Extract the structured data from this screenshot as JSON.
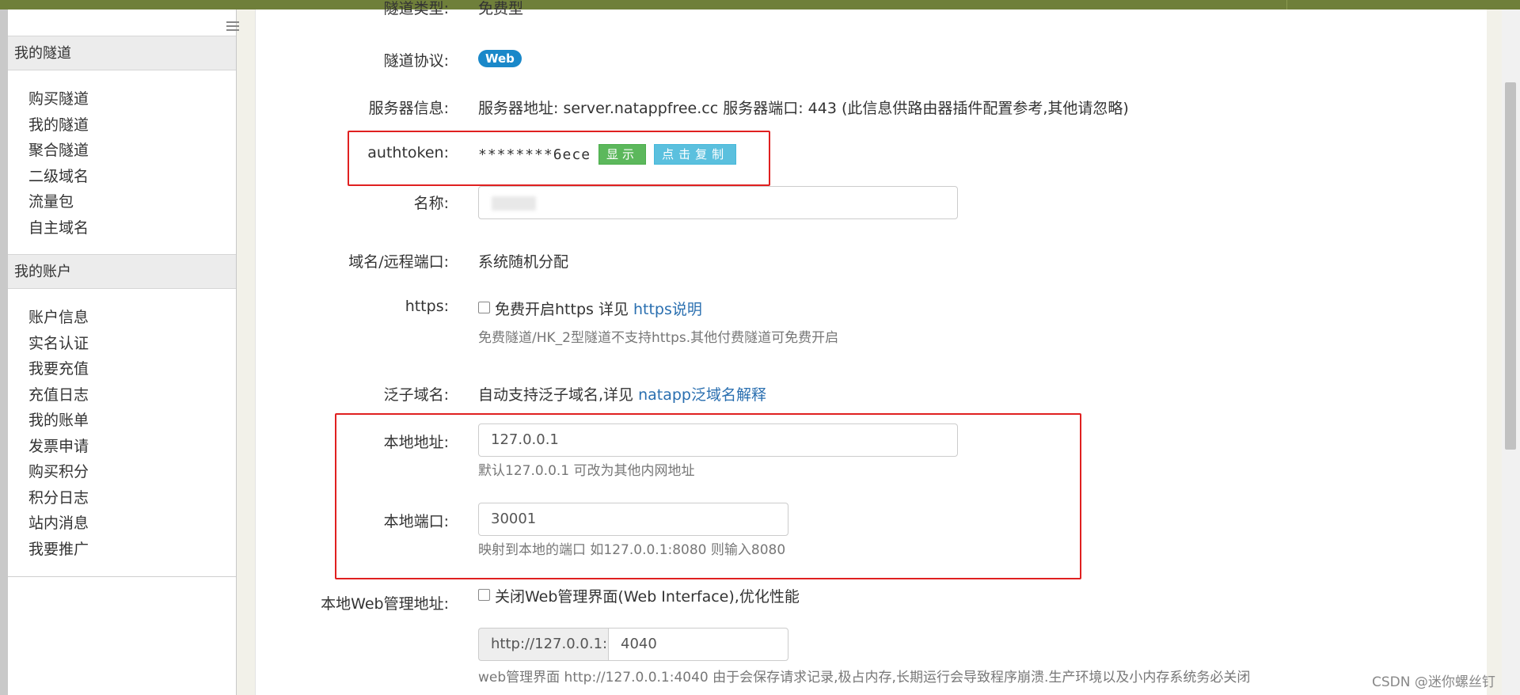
{
  "sidebar": {
    "sections": [
      {
        "title": "我的隧道",
        "items": [
          "购买隧道",
          "我的隧道",
          "聚合隧道",
          "二级域名",
          "流量包",
          "自主域名"
        ]
      },
      {
        "title": "我的账户",
        "items": [
          "账户信息",
          "实名认证",
          "我要充值",
          "充值日志",
          "我的账单",
          "发票申请",
          "购买积分",
          "积分日志",
          "站内消息",
          "我要推广"
        ]
      }
    ]
  },
  "form": {
    "tunnel_type": {
      "label": "隧道类型:",
      "value": "免费型"
    },
    "protocol": {
      "label": "隧道协议:",
      "badge": "Web"
    },
    "server": {
      "label": "服务器信息:",
      "value": "服务器地址: server.natappfree.cc 服务器端口: 443 (此信息供路由器插件配置参考,其他请忽略)"
    },
    "authtoken": {
      "label": "authtoken:",
      "value": "********6ece",
      "show_btn": "显示",
      "copy_btn": "点击复制"
    },
    "name": {
      "label": "名称:"
    },
    "domain_port": {
      "label": "域名/远程端口:",
      "value": "系统随机分配"
    },
    "https": {
      "label": "https:",
      "checkbox_text": "免费开启https 详见 ",
      "link": "https说明",
      "help": "免费隧道/HK_2型隧道不支持https.其他付费隧道可免费开启"
    },
    "wildcard": {
      "label": "泛子域名:",
      "text": "自动支持泛子域名,详见 ",
      "link": "natapp泛域名解释"
    },
    "local_addr": {
      "label": "本地地址:",
      "value": "127.0.0.1",
      "help": "默认127.0.0.1 可改为其他内网地址"
    },
    "local_port": {
      "label": "本地端口:",
      "value": "30001",
      "help": "映射到本地的端口 如127.0.0.1:8080 则输入8080"
    },
    "web_admin": {
      "label": "本地Web管理地址:",
      "checkbox_text": "关闭Web管理界面(Web Interface),优化性能",
      "addon": "http://127.0.0.1:",
      "port": "4040",
      "help": "web管理界面 http://127.0.0.1:4040 由于会保存请求记录,极占内存,长期运行会导致程序崩溃.生产环境以及小内存系统务必关闭"
    }
  },
  "watermark": "CSDN @迷你螺丝钉",
  "colors": {
    "topbar": "#6f7f3a",
    "highlight": "#e02020",
    "link": "#2a6fb0"
  }
}
